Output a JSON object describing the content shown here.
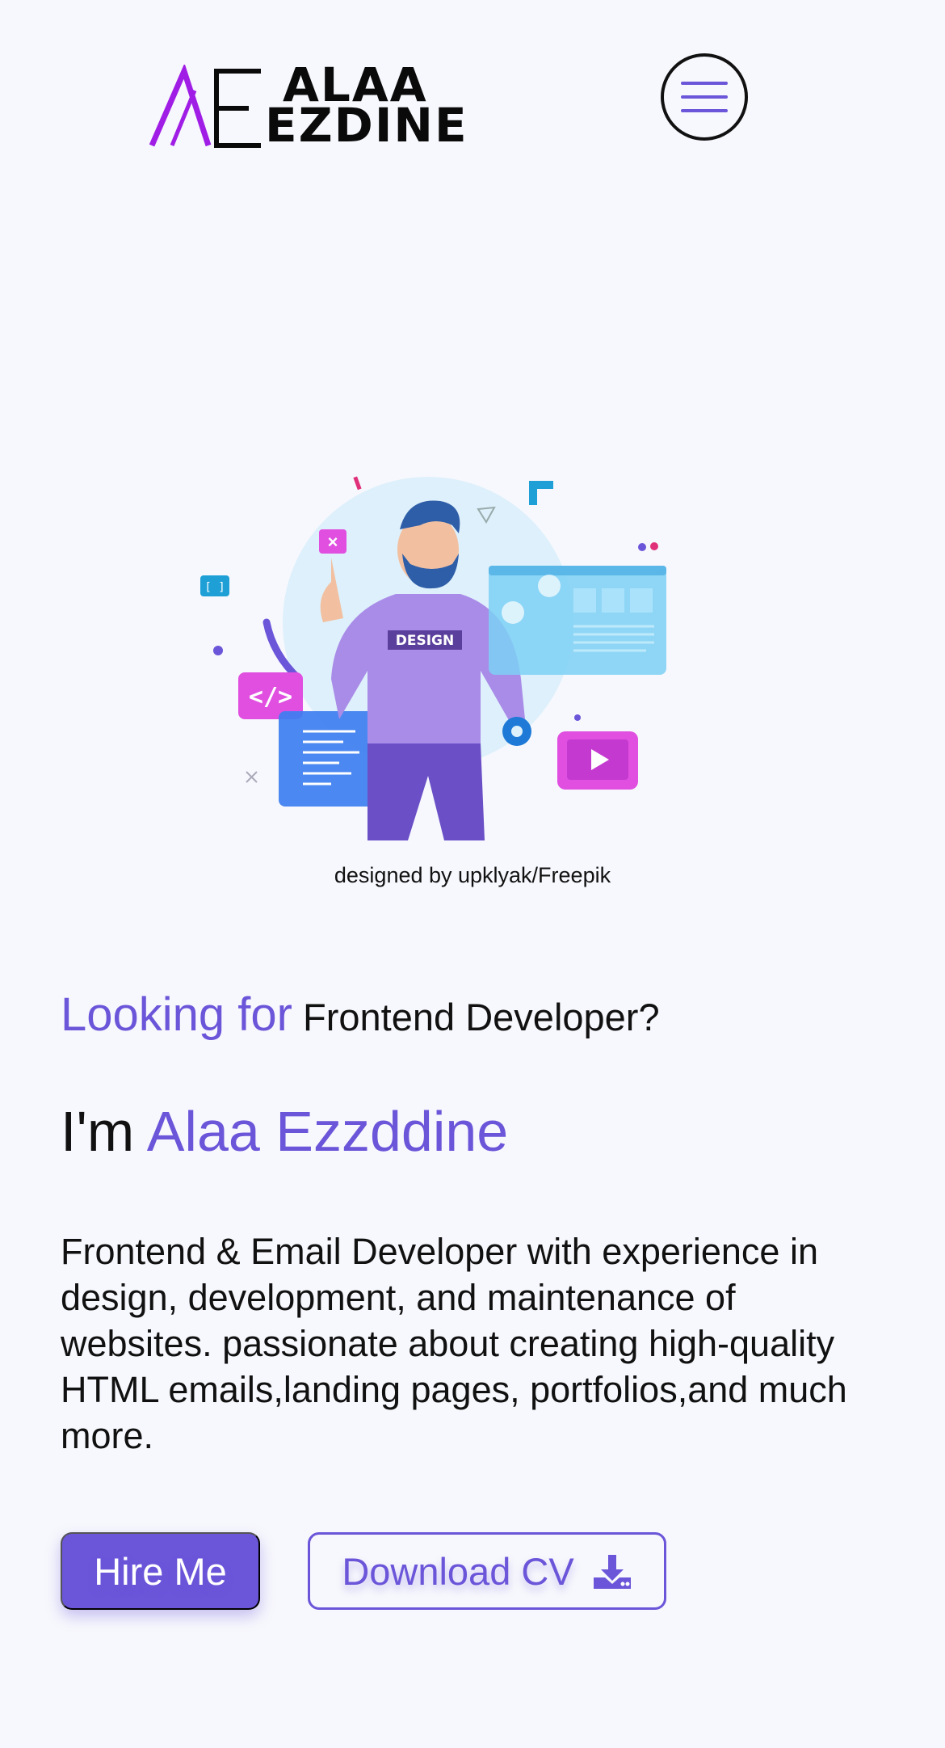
{
  "header": {
    "logo": {
      "line1": "ALAA",
      "line2": "EZDINE",
      "monogram": "AE"
    },
    "menu_icon": "hamburger-menu-icon"
  },
  "hero": {
    "illustration_badge": "DESIGN",
    "credit": "designed by upklyak/Freepik"
  },
  "intro": {
    "looking_accent": "Looking for",
    "looking_rest": "Frontend Developer?",
    "im_prefix": "I'm",
    "name": "Alaa Ezzddine",
    "bio": "Frontend & Email Developer with experience in design, development, and maintenance of websites. passionate about creating high-quality HTML emails,landing pages, portfolios,and much more."
  },
  "actions": {
    "hire_label": "Hire Me",
    "cv_label": "Download CV",
    "cv_icon": "download-icon"
  },
  "colors": {
    "accent": "#6b55d9",
    "background": "#f7f8fd",
    "text": "#111111"
  }
}
